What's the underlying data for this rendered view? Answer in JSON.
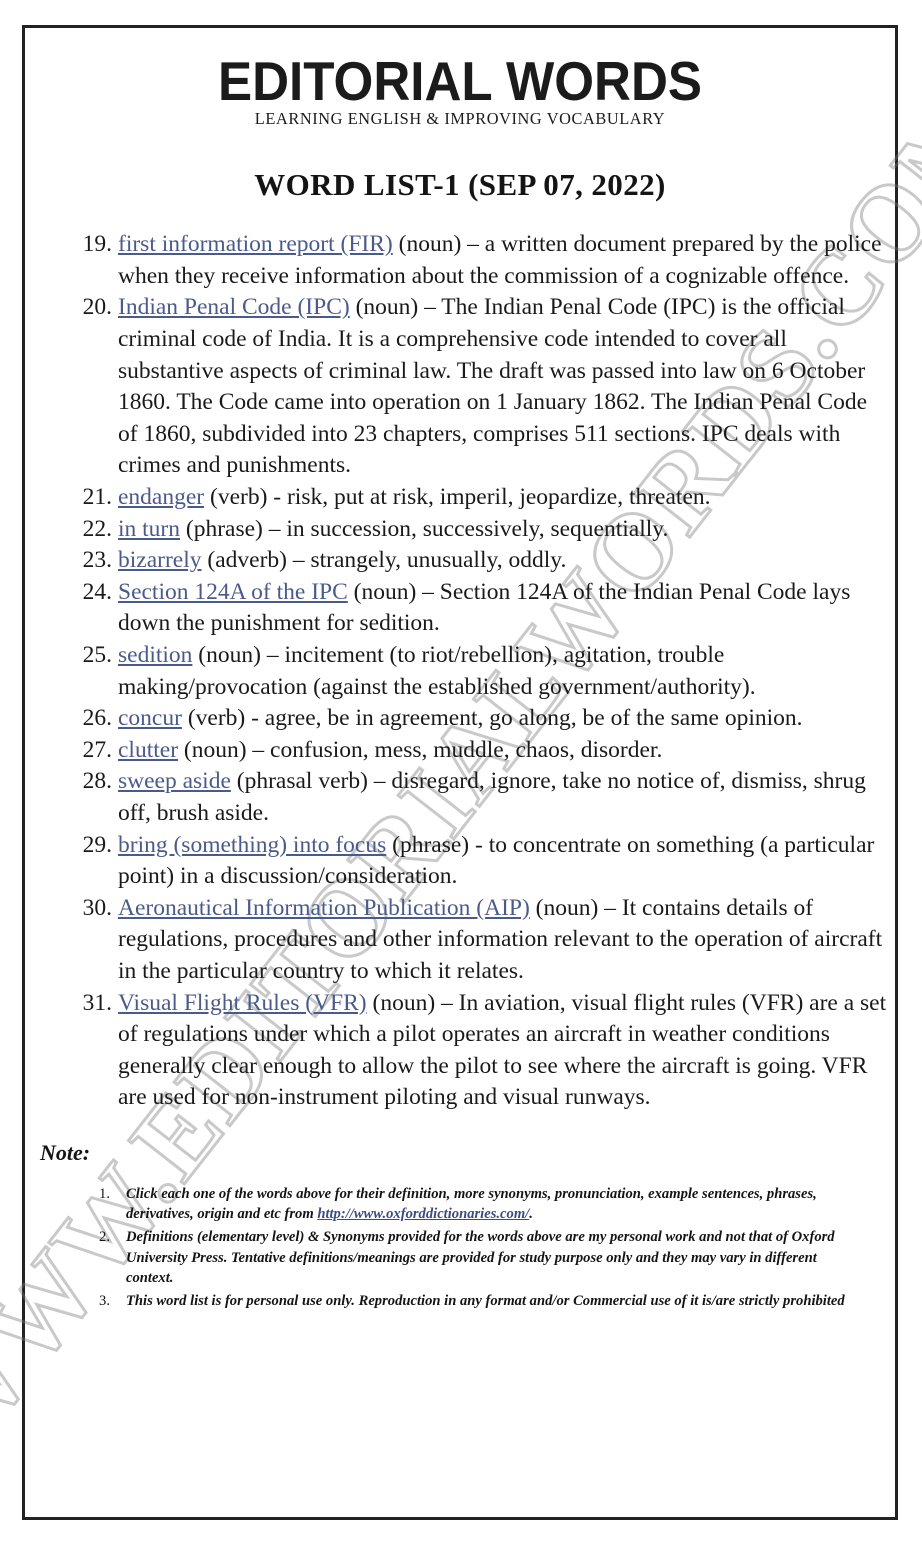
{
  "masthead": {
    "logo_text": "EDITORIAL WORDS",
    "tagline": "LEARNING ENGLISH & IMPROVING VOCABULARY"
  },
  "page_title": "WORD LIST-1 (SEP 07, 2022)",
  "watermark": {
    "text": "WWW.EDITORIALWORDS.COM"
  },
  "colors": {
    "headword_link": "#4a5a8c",
    "body_text": "#1a1a1a",
    "border": "#222222",
    "note_link": "#3a4a86"
  },
  "word_list": [
    {
      "number": "19.",
      "headword": "first information report (FIR)",
      "definition": " (noun) – a written document prepared by the police when they receive information about the commission of a cognizable offence."
    },
    {
      "number": "20.",
      "headword": "Indian Penal Code (IPC)",
      "definition": " (noun) – The Indian Penal Code (IPC) is the official criminal code of India. It is a comprehensive code intended to cover all substantive aspects of criminal law. The draft was passed into law on 6 October 1860. The Code came into operation on 1 January 1862. The Indian Penal Code of 1860, subdivided into 23 chapters, comprises 511 sections. IPC deals with crimes and punishments."
    },
    {
      "number": "21.",
      "headword": "endanger",
      "definition": " (verb) - risk, put at risk, imperil, jeopardize, threaten."
    },
    {
      "number": "22.",
      "headword": "in turn",
      "definition": " (phrase) – in succession, successively, sequentially."
    },
    {
      "number": "23.",
      "headword": "bizarrely",
      "definition": " (adverb) – strangely, unusually, oddly."
    },
    {
      "number": "24.",
      "headword": "Section 124A of the IPC",
      "definition": " (noun) – Section 124A of the Indian Penal Code lays down the punishment for sedition."
    },
    {
      "number": "25.",
      "headword": "sedition",
      "definition": " (noun) – incitement (to riot/rebellion), agitation, trouble making/provocation (against the established government/authority)."
    },
    {
      "number": "26.",
      "headword": "concur",
      "definition": " (verb) - agree, be in agreement, go along, be of the same opinion."
    },
    {
      "number": "27.",
      "headword": "clutter",
      "definition": " (noun) – confusion, mess, muddle, chaos, disorder."
    },
    {
      "number": "28.",
      "headword": "sweep aside",
      "definition": " (phrasal verb) – disregard, ignore, take no notice of, dismiss, shrug off, brush aside."
    },
    {
      "number": "29.",
      "headword": "bring (something) into focus",
      "definition": " (phrase) - to concentrate on something (a particular point) in a discussion/consideration."
    },
    {
      "number": "30.",
      "headword": "Aeronautical Information Publication (AIP)",
      "definition": " (noun) – It contains details of regulations, procedures and other information relevant to the operation of aircraft in the particular country to which it relates."
    },
    {
      "number": "31.",
      "headword": "Visual Flight Rules (VFR)",
      "definition": " (noun) – In aviation, visual flight rules (VFR) are a set of regulations under which a pilot operates an aircraft in weather conditions generally clear enough to allow the pilot to see where the aircraft is going. VFR are used for non-instrument piloting and visual runways."
    }
  ],
  "note": {
    "label": "Note:",
    "items": [
      {
        "number": "1.",
        "text_before": "Click each one of the words above for their definition, more synonyms, pronunciation, example sentences, phrases, derivatives, origin and etc from ",
        "link": "http://www.oxforddictionaries.com/",
        "text_after": "."
      },
      {
        "number": "2.",
        "text_before": "Definitions (elementary level) & Synonyms provided for the words above are my personal work and not that of Oxford University Press. Tentative definitions/meanings are provided for study purpose only and they may vary in different context.",
        "link": "",
        "text_after": ""
      },
      {
        "number": "3.",
        "text_before": "This word list is for personal use only. Reproduction in any format and/or Commercial use of it is/are strictly prohibited",
        "link": "",
        "text_after": ""
      }
    ]
  }
}
